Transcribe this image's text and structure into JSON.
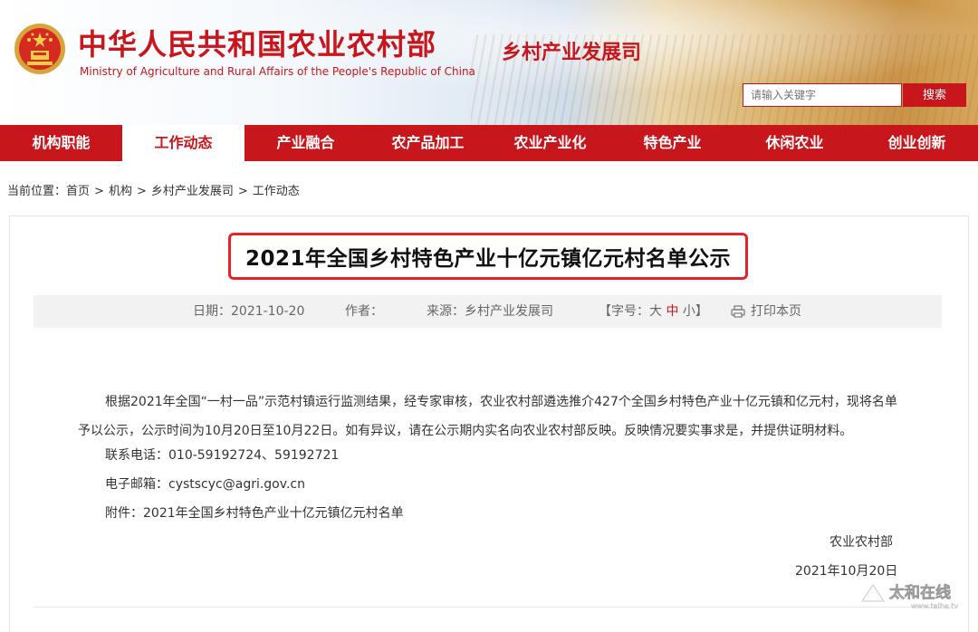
{
  "header": {
    "site_title": "中华人民共和国农业农村部",
    "site_subtitle": "Ministry of Agriculture and Rural Affairs of the People's Republic of China",
    "department": "乡村产业发展司",
    "search_placeholder": "请输入关键字",
    "search_button": "搜索"
  },
  "nav": {
    "items": [
      {
        "label": "机构职能"
      },
      {
        "label": "工作动态"
      },
      {
        "label": "产业融合"
      },
      {
        "label": "农产品加工"
      },
      {
        "label": "农业产业化"
      },
      {
        "label": "特色产业"
      },
      {
        "label": "休闲农业"
      },
      {
        "label": "创业创新"
      }
    ],
    "active_index": 1
  },
  "breadcrumb": {
    "prefix": "当前位置：",
    "items": [
      "首页",
      "机构",
      "乡村产业发展司",
      "工作动态"
    ],
    "separator": ">"
  },
  "article": {
    "title": "2021年全国乡村特色产业十亿元镇亿元村名单公示",
    "meta": {
      "date": "日期：2021-10-20",
      "author": "作者：",
      "source": "来源：乡村产业发展司",
      "font_size_label": "【字号：",
      "size_large": "大",
      "size_medium": "中",
      "size_small": "小",
      "font_size_end": "】",
      "print": "打印本页"
    },
    "paragraph": "根据2021年全国“一村一品”示范村镇运行监测结果，经专家审核，农业农村部遴选推介427个全国乡村特色产业十亿元镇和亿元村，现将名单予以公示，公示时间为10月20日至10月22日。如有异议，请在公示期内实名向农业农村部反映。反映情况要实事求是，并提供证明材料。",
    "phone": "联系电话：010-59192724、59192721",
    "email": "电子邮箱：cystscyc@agri.gov.cn",
    "attachment": "附件：2021年全国乡村特色产业十亿元镇亿元村名单",
    "signature": "农业农村部",
    "sign_date": "2021年10月20日"
  },
  "watermark": {
    "text": "太和在线",
    "domain": "www.taihe.tv"
  },
  "colors": {
    "brand_red": "#c8161d",
    "highlight_red": "#e3222a"
  }
}
